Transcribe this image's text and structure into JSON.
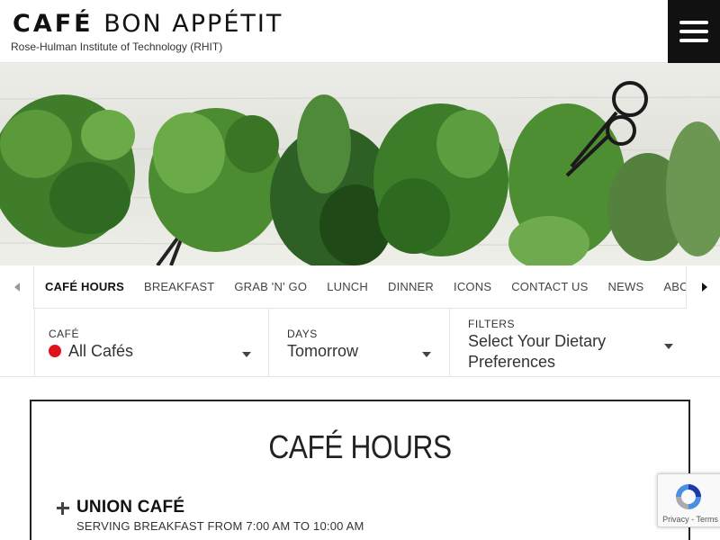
{
  "header": {
    "logo_bold": "CAFÉ",
    "logo_light": "BON APPÉTIT",
    "subtitle": "Rose-Hulman Institute of Technology (RHIT)",
    "menu_icon": "hamburger-menu-icon"
  },
  "hero": {
    "description_icon": "herbs-banner-image"
  },
  "nav": {
    "items": [
      {
        "label": "CAFÉ HOURS",
        "active": true
      },
      {
        "label": "BREAKFAST",
        "active": false
      },
      {
        "label": "GRAB 'N' GO",
        "active": false
      },
      {
        "label": "LUNCH",
        "active": false
      },
      {
        "label": "DINNER",
        "active": false
      },
      {
        "label": "ICONS",
        "active": false
      },
      {
        "label": "CONTACT US",
        "active": false
      },
      {
        "label": "NEWS",
        "active": false
      },
      {
        "label": "ABOUT YOUR CAFÉ",
        "active": false
      }
    ]
  },
  "filters": {
    "cafe_label": "CAFÉ",
    "cafe_value": "All Cafés",
    "cafe_dot_color": "#e0121b",
    "days_label": "DAYS",
    "days_value": "Tomorrow",
    "diet_label": "FILTERS",
    "diet_value_line1": "Select Your Dietary",
    "diet_value_line2": "Preferences"
  },
  "main": {
    "title": "CAFÉ HOURS",
    "cafes": [
      {
        "name": "UNION CAFÉ",
        "hours": "SERVING BREAKFAST FROM 7:00 AM TO 10:00 AM"
      }
    ]
  },
  "recaptcha": {
    "privacy": "Privacy",
    "separator": "-",
    "terms": "Terms"
  }
}
